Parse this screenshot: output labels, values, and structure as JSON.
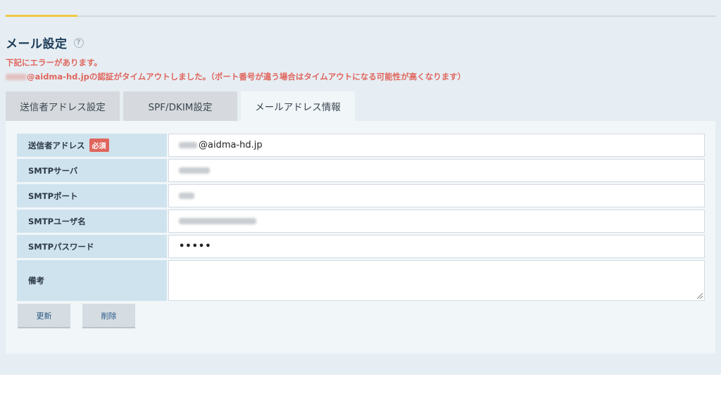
{
  "page": {
    "title": "メール設定",
    "help_icon": "question-circle-icon"
  },
  "errors": {
    "line1": "下記にエラーがあります。",
    "line2": "@aidma-hd.jpの認証がタイムアウトしました。（ポート番号が違う場合はタイムアウトになる可能性が高くなります）"
  },
  "tabs": [
    {
      "label": "送信者アドレス設定",
      "active": false
    },
    {
      "label": "SPF/DKIM設定",
      "active": false
    },
    {
      "label": "メールアドレス情報",
      "active": true
    }
  ],
  "form": {
    "sender_address": {
      "label": "送信者アドレス",
      "required_badge": "必須",
      "value": "@aidma-hd.jp"
    },
    "smtp_server": {
      "label": "SMTPサーバ"
    },
    "smtp_port": {
      "label": "SMTPポート"
    },
    "smtp_user": {
      "label": "SMTPユーザ名"
    },
    "smtp_password": {
      "label": "SMTPパスワード",
      "value": "•••••"
    },
    "notes": {
      "label": "備考",
      "value": ""
    }
  },
  "buttons": {
    "update": "更新",
    "delete": "削除"
  },
  "colors": {
    "error": "#e0655c",
    "accent": "#f0c93f",
    "label_bg": "#cfe3ee",
    "title": "#1e3d59"
  }
}
